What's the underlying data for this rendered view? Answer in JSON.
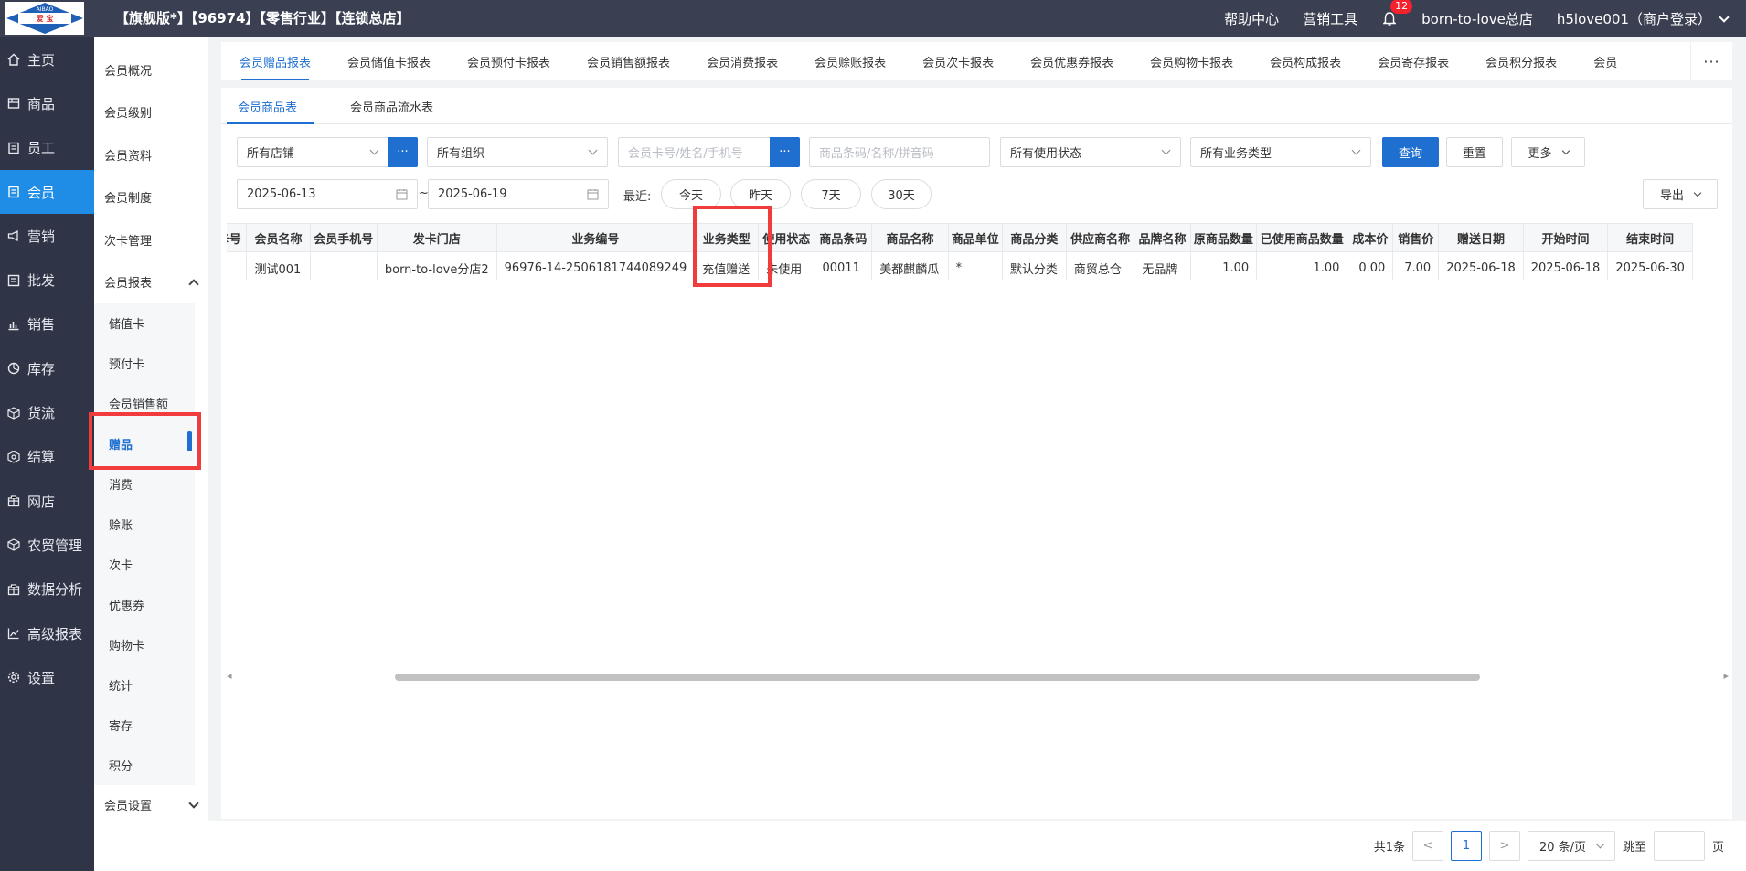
{
  "header": {
    "logo_text_top": "AIBAO",
    "logo_text_bottom": "爱 宝",
    "title": "【旗舰版*】【96974】【零售行业】【连锁总店】",
    "help": "帮助中心",
    "marketing_tools": "营销工具",
    "notification_count": "12",
    "store": "born-to-love总店",
    "user": "h5love001（商户登录）"
  },
  "left_nav": [
    {
      "label": "主页",
      "icon": "home-icon"
    },
    {
      "label": "商品",
      "icon": "product-icon"
    },
    {
      "label": "员工",
      "icon": "staff-icon"
    },
    {
      "label": "会员",
      "icon": "member-icon"
    },
    {
      "label": "营销",
      "icon": "megaphone-icon"
    },
    {
      "label": "批发",
      "icon": "wholesale-icon"
    },
    {
      "label": "销售",
      "icon": "bar-chart-icon"
    },
    {
      "label": "库存",
      "icon": "pie-icon"
    },
    {
      "label": "货流",
      "icon": "logistics-icon"
    },
    {
      "label": "结算",
      "icon": "settlement-icon"
    },
    {
      "label": "网店",
      "icon": "shop-icon"
    },
    {
      "label": "农贸管理",
      "icon": "farm-icon"
    },
    {
      "label": "数据分析",
      "icon": "analysis-icon"
    },
    {
      "label": "高级报表",
      "icon": "line-chart-icon"
    },
    {
      "label": "设置",
      "icon": "gear-icon"
    }
  ],
  "sub_nav": {
    "items": [
      "会员概况",
      "会员级别",
      "会员资料",
      "会员制度",
      "次卡管理"
    ],
    "report_group": "会员报表",
    "report_children": [
      "储值卡",
      "预付卡",
      "会员销售额",
      "赠品",
      "消费",
      "赊账",
      "次卡",
      "优惠券",
      "购物卡",
      "统计",
      "寄存",
      "积分"
    ],
    "settings_group": "会员设置"
  },
  "tabs": [
    "会员赠品报表",
    "会员储值卡报表",
    "会员预付卡报表",
    "会员销售额报表",
    "会员消费报表",
    "会员赊账报表",
    "会员次卡报表",
    "会员优惠券报表",
    "会员购物卡报表",
    "会员构成报表",
    "会员寄存报表",
    "会员积分报表",
    "会员"
  ],
  "tabs_more": "···",
  "subtabs": [
    "会员商品表",
    "会员商品流水表"
  ],
  "filters": {
    "store": "所有店铺",
    "org": "所有组织",
    "card_placeholder": "会员卡号/姓名/手机号",
    "goods_placeholder": "商品条码/名称/拼音码",
    "use_status": "所有使用状态",
    "biz_type": "所有业务类型",
    "dots": "···",
    "query": "查询",
    "reset": "重置",
    "more": "更多",
    "date_start": "2025-06-13",
    "date_sep": "~",
    "date_end": "2025-06-19",
    "recent_label": "最近:",
    "today": "今天",
    "yesterday": "昨天",
    "d7": "7天",
    "d30": "30天",
    "export": "导出"
  },
  "table": {
    "columns": [
      "会员卡号",
      "会员名称",
      "会员手机号",
      "发卡门店",
      "业务编号",
      "业务类型",
      "使用状态",
      "商品条码",
      "商品名称",
      "商品单位",
      "商品分类",
      "供应商名称",
      "品牌名称",
      "原商品数量",
      "已使用商品数量",
      "成本价",
      "销售价",
      "赠送日期",
      "开始时间",
      "结束时间"
    ],
    "rows": [
      [
        "",
        "测试001",
        "",
        "born-to-love分店2",
        "96976-14-2506181744089249",
        "充值赠送",
        "未使用",
        "00011",
        "美都麒麟瓜",
        "*",
        "默认分类",
        "商贸总仓",
        "无品牌",
        "1.00",
        "1.00",
        "0.00",
        "7.00",
        "2025-06-18",
        "2025-06-18",
        "2025-06-30"
      ]
    ]
  },
  "pager": {
    "total": "共1条",
    "prev": "<",
    "current": "1",
    "next": ">",
    "size": "20 条/页",
    "jump_label": "跳至",
    "page_suffix": "页"
  }
}
